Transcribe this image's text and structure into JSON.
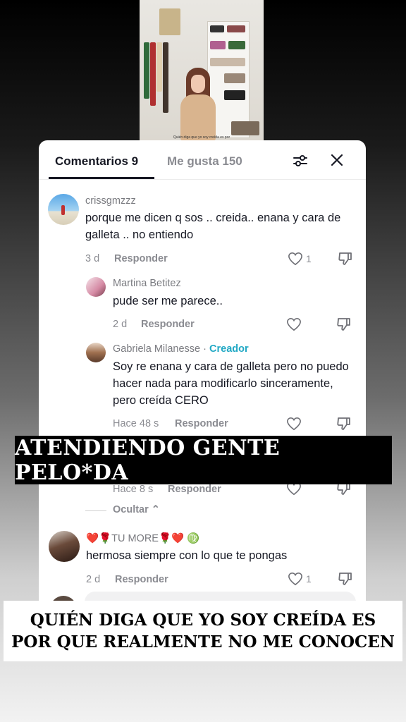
{
  "tabs": {
    "comments": "Comentarios 9",
    "likes": "Me gusta 150"
  },
  "icons": {
    "filter": "sliders-icon",
    "close": "close-icon",
    "like": "heart-outline-icon",
    "dislike": "thumbs-down-icon"
  },
  "video": {
    "caption": "Quién diga que yo soy creída es por"
  },
  "comments": [
    {
      "username": "crissgmzzz",
      "text": "porque me dicen q sos .. creida.. enana y cara de galleta .. no entiendo",
      "time": "3 d",
      "reply": "Responder",
      "likes": "1"
    },
    {
      "username": "Martina Betitez",
      "text": "pude ser me parece..",
      "time": "2 d",
      "reply": "Responder",
      "likes": ""
    },
    {
      "username": "Gabriela Milanesse",
      "separator": " · ",
      "badge": "Creador",
      "text": "Soy re enana y cara de galleta pero no puedo hacer nada para modificarlo sinceramente, pero creída CERO",
      "time": "Hace 48 s",
      "reply": "Responder",
      "likes": ""
    },
    {
      "time": "Hace 8 s",
      "reply": "Responder"
    },
    {
      "username": "❤️🌹TU MORE🌹❤️ ♍",
      "text": "hermosa siempre con lo que te pongas",
      "time": "2 d",
      "reply": "Responder",
      "likes": "1"
    }
  ],
  "hide_replies": "Ocultar ⌃",
  "overlay": {
    "banner_top": "ATENDIENDO GENTE PELO*DA",
    "banner_bottom": "QUIÉN DIGA QUE YO SOY CREÍDA ES POR QUE REALMENTE NO ME CONOCEN"
  },
  "colors": {
    "creator_badge": "#20a8c4",
    "text_primary": "#161823",
    "text_secondary": "#8a8b91"
  }
}
